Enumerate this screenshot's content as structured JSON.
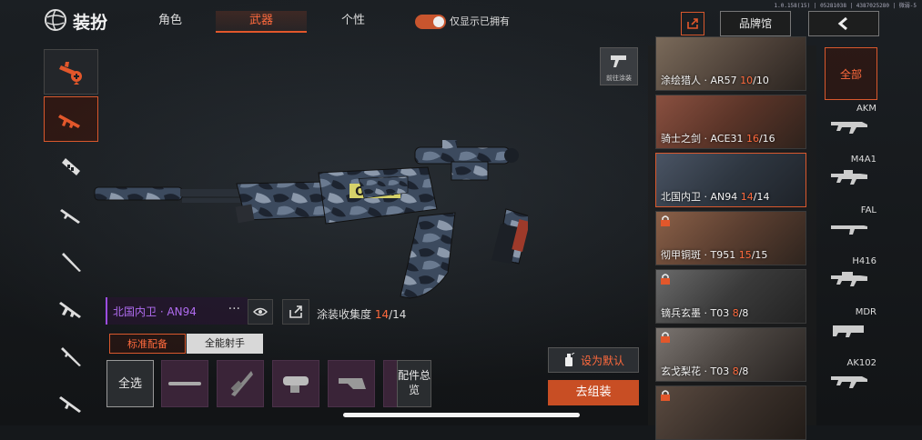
{
  "status": {
    "version": "1.0.158(15) | 05281038 | 4387025280 | 微弱-5"
  },
  "header": {
    "title": "装扮",
    "tabs": [
      {
        "label": "角色",
        "active": false
      },
      {
        "label": "武器",
        "active": true
      },
      {
        "label": "个性",
        "active": false
      }
    ],
    "toggle_label": "仅显示已拥有",
    "toggle_on": true,
    "brand_label": "品牌馆"
  },
  "categories": [
    {
      "icon": "weapon-skin-icon",
      "active": false
    },
    {
      "icon": "assault-rifle-icon",
      "active": true
    },
    {
      "icon": "smg-icon",
      "active": false
    },
    {
      "icon": "sniper-icon",
      "active": false
    },
    {
      "icon": "marksman-icon",
      "active": false
    },
    {
      "icon": "lmg-icon",
      "active": false
    },
    {
      "icon": "shotgun-icon",
      "active": false
    },
    {
      "icon": "rifle-icon",
      "active": false
    }
  ],
  "goto_paint_label": "前往涂装",
  "weapon": {
    "name": "北国内卫 · AN94",
    "decal_text": "ONOH"
  },
  "collection": {
    "label": "涂装收集度",
    "owned": "14",
    "total": "/14"
  },
  "loadout_tabs": [
    {
      "label": "标准配备",
      "active": true
    },
    {
      "label": "全能射手",
      "active": false
    }
  ],
  "select_all_label": "全选",
  "attachments_overview_label": "配件总览",
  "set_default_label": "设为默认",
  "assemble_label": "去组装",
  "skins": [
    {
      "name": "涂绘猎人 · AR57 ",
      "owned": "10",
      "total": "/10",
      "locked": false,
      "active": false
    },
    {
      "name": "骑士之剑 · ACE31 ",
      "owned": "16",
      "total": "/16",
      "locked": false,
      "active": false
    },
    {
      "name": "北国内卫 · AN94 ",
      "owned": "14",
      "total": "/14",
      "locked": false,
      "active": true
    },
    {
      "name": "彻甲铜斑 · T951 ",
      "owned": "15",
      "total": "/15",
      "locked": true,
      "active": false
    },
    {
      "name": "镝兵玄墨 · T03 ",
      "owned": "8",
      "total": "/8",
      "locked": true,
      "active": false
    },
    {
      "name": "玄戈梨花 · T03 ",
      "owned": "8",
      "total": "/8",
      "locked": true,
      "active": false
    },
    {
      "name": "",
      "owned": "",
      "total": "",
      "locked": true,
      "active": false
    }
  ],
  "weapon_types": {
    "all_label": "全部",
    "items": [
      "AKM",
      "M4A1",
      "FAL",
      "H416",
      "MDR",
      "AK102"
    ]
  },
  "colors": {
    "accent": "#d9582d",
    "accent_text": "#ff6a3d",
    "purple": "#b06cf0"
  }
}
